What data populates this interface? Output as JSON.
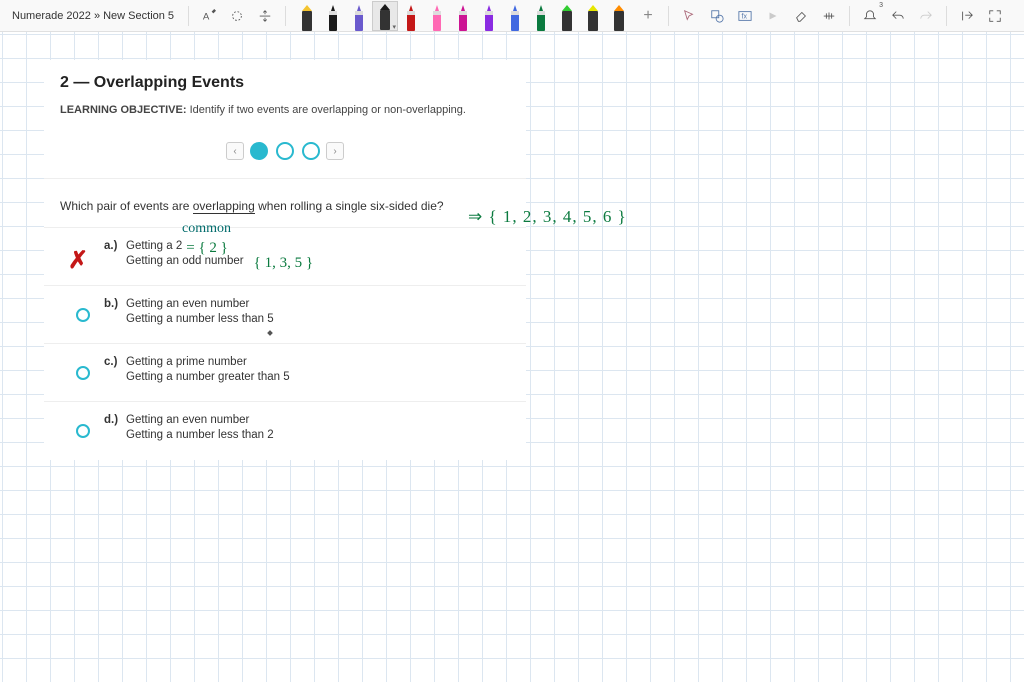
{
  "breadcrumb": "Numerade 2022  »  New Section 5",
  "pens": [
    {
      "color": "#f4c430",
      "type": "hl"
    },
    {
      "color": "#1a1a1a",
      "type": "pen"
    },
    {
      "color": "#6a5acd",
      "type": "pen"
    },
    {
      "color": "#1a1a1a",
      "type": "hl",
      "sel": true
    },
    {
      "color": "#c41818",
      "type": "pen"
    },
    {
      "color": "#ff69b4",
      "type": "pen"
    },
    {
      "color": "#cc1493",
      "type": "pen"
    },
    {
      "color": "#8a2be2",
      "type": "pen"
    },
    {
      "color": "#4169e1",
      "type": "pen"
    },
    {
      "color": "#0b7a3f",
      "type": "pen"
    },
    {
      "color": "#32cd32",
      "type": "hl"
    },
    {
      "color": "#e6e600",
      "type": "hl"
    },
    {
      "color": "#ff8c00",
      "type": "hl"
    }
  ],
  "card": {
    "title": "2 — Overlapping Events",
    "lo_label": "LEARNING OBJECTIVE:",
    "lo_text": " Identify if two events are overlapping or non-overlapping.",
    "question_pre": "Which pair of events are ",
    "question_ul": "overlapping",
    "question_post": " when rolling a single six-sided die?",
    "options": [
      {
        "lab": "a.)",
        "l1": "Getting a 2",
        "l2": "Getting an odd number",
        "mark": "x"
      },
      {
        "lab": "b.)",
        "l1": "Getting an even number",
        "l2": "Getting a number less than 5",
        "mark": ""
      },
      {
        "lab": "c.)",
        "l1": "Getting a prime number",
        "l2": "Getting a number greater than 5",
        "mark": ""
      },
      {
        "lab": "d.)",
        "l1": "Getting an even number",
        "l2": "Getting a number less than 2",
        "mark": ""
      }
    ]
  },
  "annotations": {
    "arrow_set": "⇒ { 1, 2, 3, 4, 5, 6 }",
    "common": "common",
    "eq2": " =   { 2 }",
    "set135": "{ 1, 3, 5 }"
  }
}
